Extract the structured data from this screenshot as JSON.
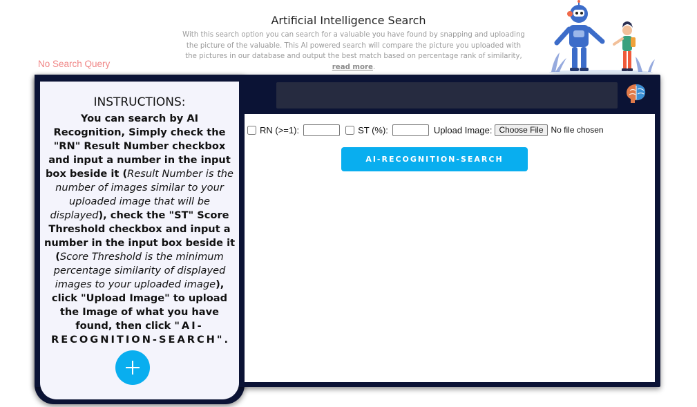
{
  "header": {
    "title": "Artificial Intelligence Search",
    "description_lines": [
      "With this search option you can search for a valuable you have found by snapping and uploading",
      "the picture of the valuable. This AI powered search will compare the picture you uploaded with",
      "the pictures in our database and output the best match based on percentage rank of similarity,"
    ],
    "read_more": "read more",
    "read_more_suffix": "."
  },
  "status": {
    "no_query": "No Search Query"
  },
  "instructions": {
    "title": "INSTRUCTIONS:",
    "p1": "You can search by AI Recognition, Simply check the \"RN\" Result Number checkbox and input a number in the input box beside it (",
    "p1_italic": "Result Number is the number of images similar to your uploaded image that will be displayed",
    "p2": "), check the \"ST\" Score Threshold checkbox and input a number in the input box beside it (",
    "p2_italic": "Score Threshold is the minimum percentage similarity of displayed images to your uploaded image",
    "p3": "), click \"Upload Image\" to upload the Image of what you have found, then click ",
    "p3_spaced": "\"AI-RECOGNITION-SEARCH\"",
    "p3_end": "."
  },
  "controls": {
    "rn_label": "RN (>=1):",
    "rn_value": "",
    "st_label": "ST (%):",
    "st_value": "",
    "upload_label": "Upload Image:",
    "choose_file": "Choose File",
    "no_file": "No file chosen"
  },
  "search_button": "AI-RECOGNITION-SEARCH",
  "colors": {
    "frame": "#0b1335",
    "accent": "#09aeef",
    "panel": "#f4f4fc",
    "search_bar": "#262b40",
    "no_query_text": "#f08585"
  },
  "icons": {
    "add": "plus-icon",
    "brain": "brain-icon",
    "illustration": "robot-and-child-illustration"
  }
}
